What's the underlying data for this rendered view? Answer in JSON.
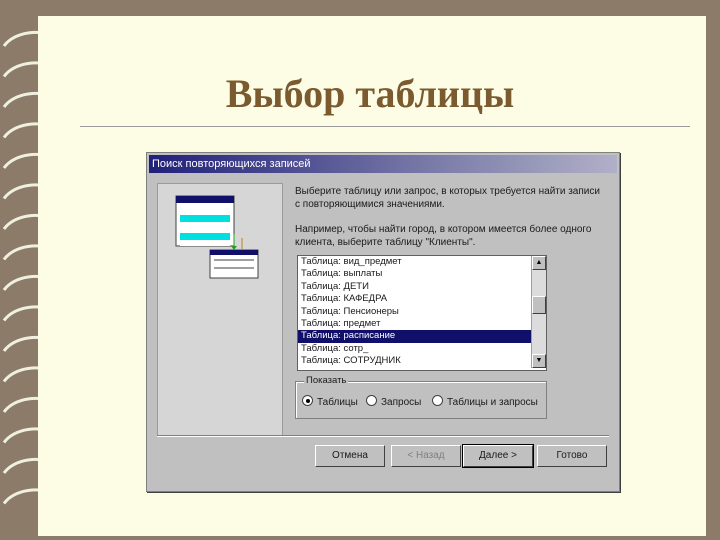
{
  "slide": {
    "title": "Выбор таблицы"
  },
  "dialog": {
    "title": "Поиск повторяющихся записей",
    "description": "Выберите таблицу или запрос, в которых требуется найти записи с повторяющимися значениями.",
    "example": "Например, чтобы найти город, в котором имеется более одного клиента, выберите таблицу \"Клиенты\".",
    "list": {
      "items": [
        "Таблица: вид_предмет",
        "Таблица: выплаты",
        "Таблица: ДЕТИ",
        "Таблица: КАФЕДРА",
        "Таблица: Пенсионеры",
        "Таблица: предмет",
        "Таблица: расписание",
        "Таблица: сотр_",
        "Таблица: СОТРУДНИК"
      ],
      "selected_index": 6
    },
    "view_group": {
      "label": "Показать",
      "options": [
        "Таблицы",
        "Запросы",
        "Таблицы и запросы"
      ],
      "selected_index": 0
    },
    "buttons": {
      "cancel": "Отмена",
      "back": "< Назад",
      "next": "Далее >",
      "finish": "Готово"
    }
  },
  "colors": {
    "accent_title": "#7a5a2e",
    "selection": "#10106a",
    "titlebar": "#20207a"
  }
}
